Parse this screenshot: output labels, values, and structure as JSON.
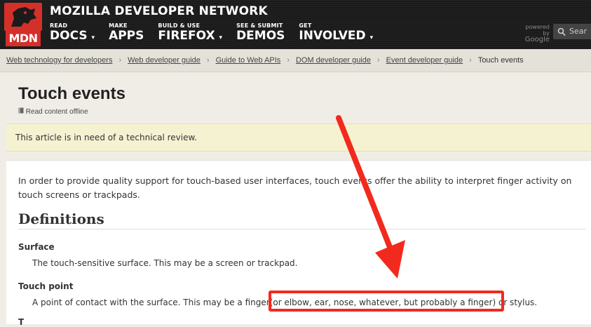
{
  "header": {
    "logo_text": "MDN",
    "site_title": "MOZILLA DEVELOPER NETWORK",
    "nav": [
      {
        "small": "READ",
        "big": "DOCS",
        "caret": "▾"
      },
      {
        "small": "MAKE",
        "big": "APPS",
        "caret": ""
      },
      {
        "small": "BUILD & USE",
        "big": "FIREFOX",
        "caret": "▾"
      },
      {
        "small": "SEE & SUBMIT",
        "big": "DEMOS",
        "caret": ""
      },
      {
        "small": "GET",
        "big": "INVOLVED",
        "caret": "▾"
      }
    ],
    "powered_by": "powered by",
    "google": "Google",
    "search_placeholder": "Sear"
  },
  "breadcrumb": {
    "items": [
      "Web technology for developers",
      "Web developer guide",
      "Guide to Web APIs",
      "DOM developer guide",
      "Event developer guide"
    ],
    "current": "Touch events",
    "separator": "›"
  },
  "page": {
    "title": "Touch events",
    "offline_link": "Read content offline",
    "notice": "This article is in need of a technical review.",
    "intro": "In order to provide quality support for touch-based user interfaces, touch events offer the ability to interpret finger activity on touch screens or trackpads.",
    "definitions_heading": "Definitions",
    "terms": [
      {
        "term": "Surface",
        "definition": "The touch-sensitive surface. This may be a screen or trackpad."
      },
      {
        "term": "Touch point",
        "def_before": "A point of contact with the surface. This may be a finger",
        "def_highlight": "(or elbow, ear, nose, whatever, but probably a finger)",
        "def_after": " or stylus."
      }
    ],
    "partial_term": "T"
  },
  "colors": {
    "accent_red": "#f22a1e",
    "logo_red": "#d4302a",
    "header_bg": "#1b1b1b"
  }
}
